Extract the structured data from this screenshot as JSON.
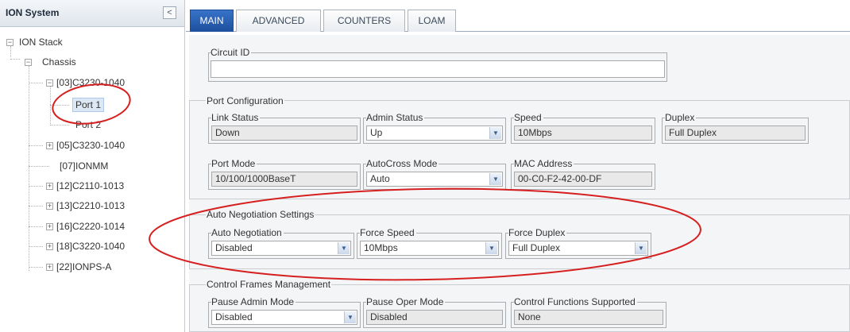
{
  "left": {
    "title": "ION System",
    "collapse_glyph": "<",
    "tree": {
      "root": "ION Stack",
      "chassis": "Chassis",
      "nodes": [
        "[03]C3230-1040",
        "Port 1",
        "Port 2",
        "[05]C3230-1040",
        "[07]IONMM",
        "[12]C2110-1013",
        "[13]C2210-1013",
        "[16]C2220-1014",
        "[18]C3220-1040",
        "[22]IONPS-A"
      ]
    },
    "toggle_minus": "−",
    "toggle_plus": "+"
  },
  "tabs": [
    "MAIN",
    "ADVANCED",
    "COUNTERS",
    "LOAM"
  ],
  "circuit": {
    "label": "Circuit ID",
    "value": ""
  },
  "port_config": {
    "title": "Port Configuration",
    "link_status": {
      "label": "Link Status",
      "value": "Down"
    },
    "admin_status": {
      "label": "Admin Status",
      "value": "Up"
    },
    "speed": {
      "label": "Speed",
      "value": "10Mbps"
    },
    "duplex": {
      "label": "Duplex",
      "value": "Full Duplex"
    },
    "port_mode": {
      "label": "Port Mode",
      "value": "10/100/1000BaseT"
    },
    "autocross": {
      "label": "AutoCross Mode",
      "value": "Auto"
    },
    "mac": {
      "label": "MAC Address",
      "value": "00-C0-F2-42-00-DF"
    }
  },
  "auto_neg": {
    "title": "Auto Negotiation Settings",
    "auto_negotiation": {
      "label": "Auto Negotiation",
      "value": "Disabled"
    },
    "force_speed": {
      "label": "Force Speed",
      "value": "10Mbps"
    },
    "force_duplex": {
      "label": "Force Duplex",
      "value": "Full Duplex"
    }
  },
  "control_frames": {
    "title": "Control Frames Management",
    "pause_admin": {
      "label": "Pause Admin Mode",
      "value": "Disabled"
    },
    "pause_oper": {
      "label": "Pause Oper Mode",
      "value": "Disabled"
    },
    "control_functions": {
      "label": "Control Functions Supported",
      "value": "None"
    }
  },
  "icons": {
    "dropdown": "chevron-down-icon",
    "collapse": "chevron-left-icon"
  },
  "colors": {
    "active_tab": "#1d4f9d",
    "annotation": "#d62020",
    "selected_node": "#dce8f6"
  }
}
